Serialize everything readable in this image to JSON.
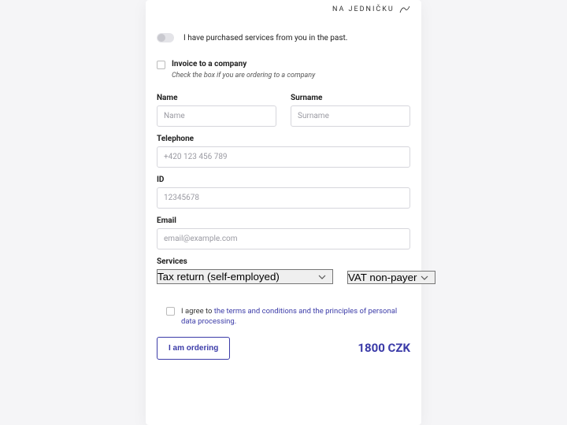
{
  "brand": "NA JEDNIČKU",
  "toggle": {
    "label": "I have purchased services from you in the past.",
    "on": false
  },
  "company_check": {
    "label": "Invoice to a company",
    "hint": "Check the box if you are ordering to a company"
  },
  "fields": {
    "name": {
      "label": "Name",
      "placeholder": "Name"
    },
    "surname": {
      "label": "Surname",
      "placeholder": "Surname"
    },
    "telephone": {
      "label": "Telephone",
      "placeholder": "+420 123 456 789"
    },
    "id": {
      "label": "ID",
      "placeholder": "12345678"
    },
    "email": {
      "label": "Email",
      "placeholder": "email@example.com"
    }
  },
  "services": {
    "label": "Services",
    "main_selected": "Tax return (self-employed)",
    "vat_selected": "VAT non-payer"
  },
  "agree": {
    "prefix": "I agree to ",
    "link": "the terms and conditions and the principles of personal data processing."
  },
  "order_button": "I am ordering",
  "price": "1800 CZK"
}
